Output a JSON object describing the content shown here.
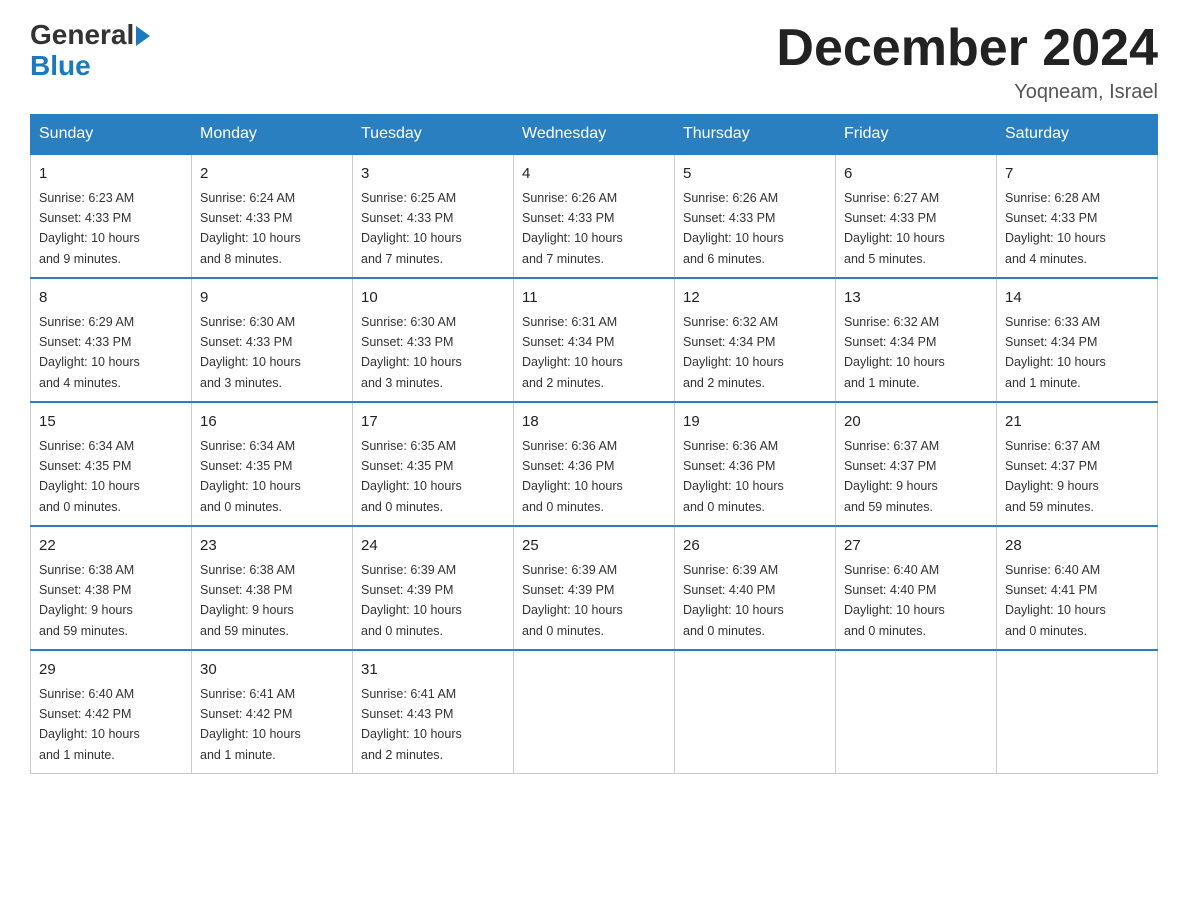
{
  "header": {
    "logo_general": "General",
    "logo_blue": "Blue",
    "month_title": "December 2024",
    "location": "Yoqneam, Israel"
  },
  "days_of_week": [
    "Sunday",
    "Monday",
    "Tuesday",
    "Wednesday",
    "Thursday",
    "Friday",
    "Saturday"
  ],
  "weeks": [
    [
      {
        "day": "1",
        "info": "Sunrise: 6:23 AM\nSunset: 4:33 PM\nDaylight: 10 hours\nand 9 minutes."
      },
      {
        "day": "2",
        "info": "Sunrise: 6:24 AM\nSunset: 4:33 PM\nDaylight: 10 hours\nand 8 minutes."
      },
      {
        "day": "3",
        "info": "Sunrise: 6:25 AM\nSunset: 4:33 PM\nDaylight: 10 hours\nand 7 minutes."
      },
      {
        "day": "4",
        "info": "Sunrise: 6:26 AM\nSunset: 4:33 PM\nDaylight: 10 hours\nand 7 minutes."
      },
      {
        "day": "5",
        "info": "Sunrise: 6:26 AM\nSunset: 4:33 PM\nDaylight: 10 hours\nand 6 minutes."
      },
      {
        "day": "6",
        "info": "Sunrise: 6:27 AM\nSunset: 4:33 PM\nDaylight: 10 hours\nand 5 minutes."
      },
      {
        "day": "7",
        "info": "Sunrise: 6:28 AM\nSunset: 4:33 PM\nDaylight: 10 hours\nand 4 minutes."
      }
    ],
    [
      {
        "day": "8",
        "info": "Sunrise: 6:29 AM\nSunset: 4:33 PM\nDaylight: 10 hours\nand 4 minutes."
      },
      {
        "day": "9",
        "info": "Sunrise: 6:30 AM\nSunset: 4:33 PM\nDaylight: 10 hours\nand 3 minutes."
      },
      {
        "day": "10",
        "info": "Sunrise: 6:30 AM\nSunset: 4:33 PM\nDaylight: 10 hours\nand 3 minutes."
      },
      {
        "day": "11",
        "info": "Sunrise: 6:31 AM\nSunset: 4:34 PM\nDaylight: 10 hours\nand 2 minutes."
      },
      {
        "day": "12",
        "info": "Sunrise: 6:32 AM\nSunset: 4:34 PM\nDaylight: 10 hours\nand 2 minutes."
      },
      {
        "day": "13",
        "info": "Sunrise: 6:32 AM\nSunset: 4:34 PM\nDaylight: 10 hours\nand 1 minute."
      },
      {
        "day": "14",
        "info": "Sunrise: 6:33 AM\nSunset: 4:34 PM\nDaylight: 10 hours\nand 1 minute."
      }
    ],
    [
      {
        "day": "15",
        "info": "Sunrise: 6:34 AM\nSunset: 4:35 PM\nDaylight: 10 hours\nand 0 minutes."
      },
      {
        "day": "16",
        "info": "Sunrise: 6:34 AM\nSunset: 4:35 PM\nDaylight: 10 hours\nand 0 minutes."
      },
      {
        "day": "17",
        "info": "Sunrise: 6:35 AM\nSunset: 4:35 PM\nDaylight: 10 hours\nand 0 minutes."
      },
      {
        "day": "18",
        "info": "Sunrise: 6:36 AM\nSunset: 4:36 PM\nDaylight: 10 hours\nand 0 minutes."
      },
      {
        "day": "19",
        "info": "Sunrise: 6:36 AM\nSunset: 4:36 PM\nDaylight: 10 hours\nand 0 minutes."
      },
      {
        "day": "20",
        "info": "Sunrise: 6:37 AM\nSunset: 4:37 PM\nDaylight: 9 hours\nand 59 minutes."
      },
      {
        "day": "21",
        "info": "Sunrise: 6:37 AM\nSunset: 4:37 PM\nDaylight: 9 hours\nand 59 minutes."
      }
    ],
    [
      {
        "day": "22",
        "info": "Sunrise: 6:38 AM\nSunset: 4:38 PM\nDaylight: 9 hours\nand 59 minutes."
      },
      {
        "day": "23",
        "info": "Sunrise: 6:38 AM\nSunset: 4:38 PM\nDaylight: 9 hours\nand 59 minutes."
      },
      {
        "day": "24",
        "info": "Sunrise: 6:39 AM\nSunset: 4:39 PM\nDaylight: 10 hours\nand 0 minutes."
      },
      {
        "day": "25",
        "info": "Sunrise: 6:39 AM\nSunset: 4:39 PM\nDaylight: 10 hours\nand 0 minutes."
      },
      {
        "day": "26",
        "info": "Sunrise: 6:39 AM\nSunset: 4:40 PM\nDaylight: 10 hours\nand 0 minutes."
      },
      {
        "day": "27",
        "info": "Sunrise: 6:40 AM\nSunset: 4:40 PM\nDaylight: 10 hours\nand 0 minutes."
      },
      {
        "day": "28",
        "info": "Sunrise: 6:40 AM\nSunset: 4:41 PM\nDaylight: 10 hours\nand 0 minutes."
      }
    ],
    [
      {
        "day": "29",
        "info": "Sunrise: 6:40 AM\nSunset: 4:42 PM\nDaylight: 10 hours\nand 1 minute."
      },
      {
        "day": "30",
        "info": "Sunrise: 6:41 AM\nSunset: 4:42 PM\nDaylight: 10 hours\nand 1 minute."
      },
      {
        "day": "31",
        "info": "Sunrise: 6:41 AM\nSunset: 4:43 PM\nDaylight: 10 hours\nand 2 minutes."
      },
      {
        "day": "",
        "info": ""
      },
      {
        "day": "",
        "info": ""
      },
      {
        "day": "",
        "info": ""
      },
      {
        "day": "",
        "info": ""
      }
    ]
  ]
}
